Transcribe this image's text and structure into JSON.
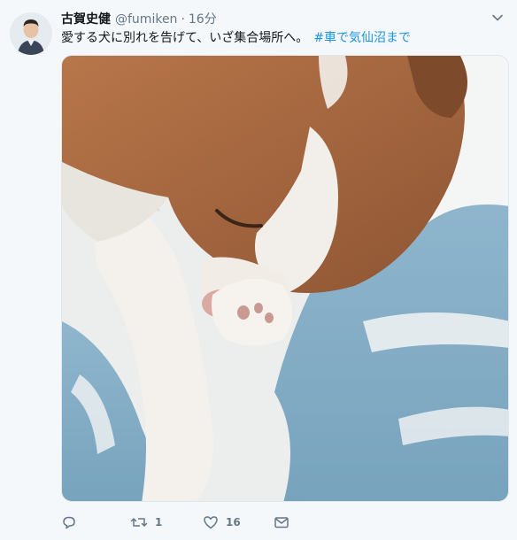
{
  "tweet": {
    "author_name": "古賀史健",
    "author_handle": "@fumiken",
    "separator": "·",
    "time": "16分",
    "text": "愛する犬に別れを告げて、いざ集合場所へ。",
    "hashtag": "#車で気仙沼まで",
    "media_icon": "sleeping-puppy-photo"
  },
  "actions": {
    "reply_count": "",
    "retweet_count": "1",
    "like_count": "16",
    "icons": [
      "reply-icon",
      "retweet-icon",
      "heart-icon",
      "direct-message-icon"
    ]
  },
  "colors": {
    "background": "#f5f8fa",
    "text": "#14171a",
    "secondary": "#657786",
    "link": "#1b95e0"
  }
}
